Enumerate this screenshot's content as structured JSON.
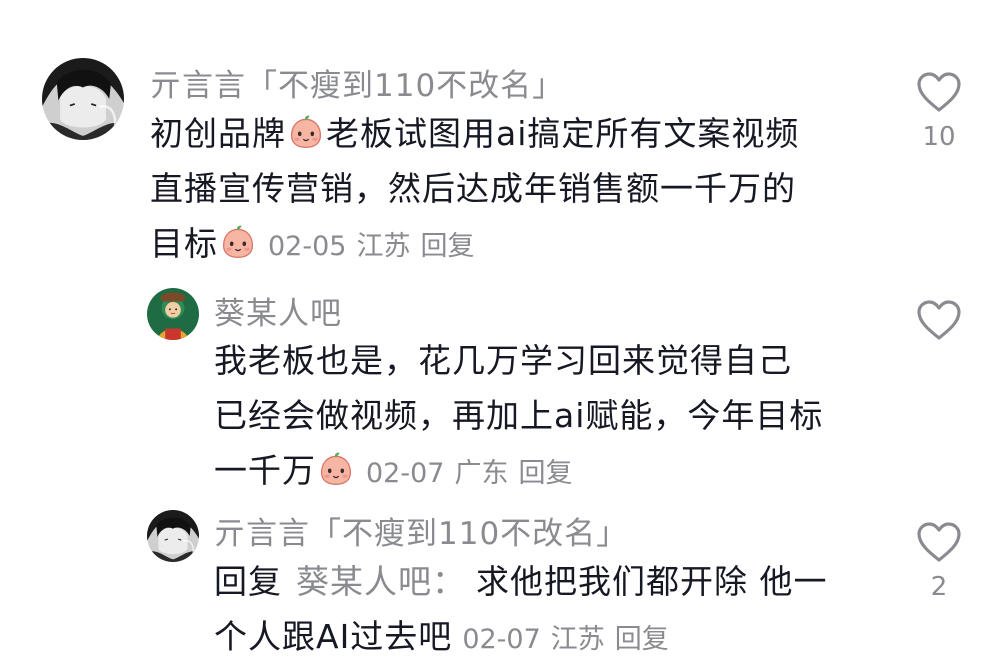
{
  "comments": [
    {
      "username": "亓言言「不瘦到110不改名」",
      "lines": [
        "初创品牌",
        "老板试图用ai搞定所有文案视频",
        "直播宣传营销，然后达成年销售额一千万的",
        "目标"
      ],
      "date": "02-05",
      "location": "江苏",
      "reply_label": "回复",
      "likes": "10",
      "avatar_icon": "dark-portrait-avatar"
    },
    {
      "username": "葵某人吧",
      "lines": [
        "我老板也是，花几万学习回来觉得自己",
        "已经会做视频，再加上ai赋能，今年目标",
        "一千万"
      ],
      "date": "02-07",
      "location": "广东",
      "reply_label": "回复",
      "likes": "",
      "avatar_icon": "green-cartoon-avatar"
    },
    {
      "username": "亓言言「不瘦到110不改名」",
      "reply_prefix": "回复",
      "reply_target": "葵某人吧：",
      "lines": [
        "求他把我们都开除 他一",
        "个人跟AI过去吧"
      ],
      "date": "02-07",
      "location": "江苏",
      "reply_label": "回复",
      "likes": "2",
      "avatar_icon": "dark-portrait-avatar"
    }
  ],
  "colors": {
    "text": "#161823",
    "muted": "#8a8b91",
    "emoji_face": "#f6b8a8"
  }
}
